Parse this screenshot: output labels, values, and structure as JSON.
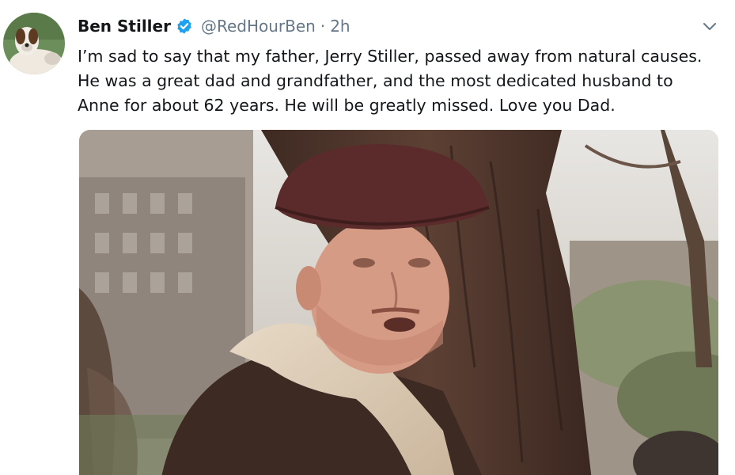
{
  "tweet": {
    "author_name": "Ben Stiller",
    "handle": "@RedHourBen",
    "separator": "·",
    "time": "2h",
    "verified_icon": "verified-badge-icon",
    "menu_icon": "chevron-down-icon",
    "text_lines": [
      "I’m sad to say that my father, Jerry Stiller, passed away from natural causes.",
      "He was a great dad and grandfather,  and the most dedicated husband to",
      "Anne for about 62 years. He will be greatly missed. Love you Dad."
    ]
  },
  "colors": {
    "text_primary": "#14171a",
    "text_secondary": "#657786",
    "verified_blue": "#1da1f2"
  }
}
